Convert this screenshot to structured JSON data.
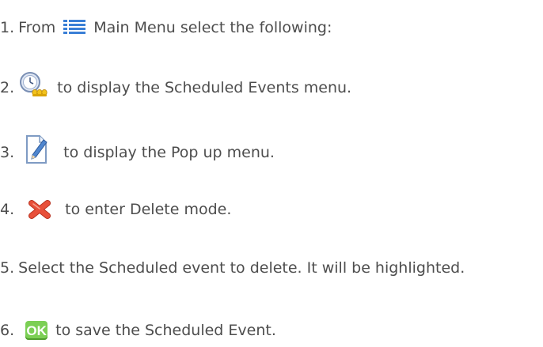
{
  "steps": [
    {
      "number": "1.",
      "prefix": "From",
      "icon": "main-menu-list-icon",
      "text": "Main Menu select the following:"
    },
    {
      "number": "2.",
      "icon": "scheduled-events-clock-icon",
      "text": "to display the Scheduled Events menu."
    },
    {
      "number": "3.",
      "icon": "edit-document-pencil-icon",
      "text": "to display the Pop up menu."
    },
    {
      "number": "4.",
      "icon": "delete-x-icon",
      "text": "to enter Delete mode."
    },
    {
      "number": "5.",
      "text": "Select the Scheduled event to delete. It will be highlighted."
    },
    {
      "number": "6.",
      "icon": "ok-icon",
      "icon_label": "OK",
      "text": "to save the Scheduled Event."
    }
  ],
  "colors": {
    "text": "#4d4d4d",
    "menu_icon_blue": "#3a7fd6",
    "ok_green": "#7bcf54",
    "delete_red": "#e8503a",
    "clock_yellow": "#f2c21b"
  }
}
